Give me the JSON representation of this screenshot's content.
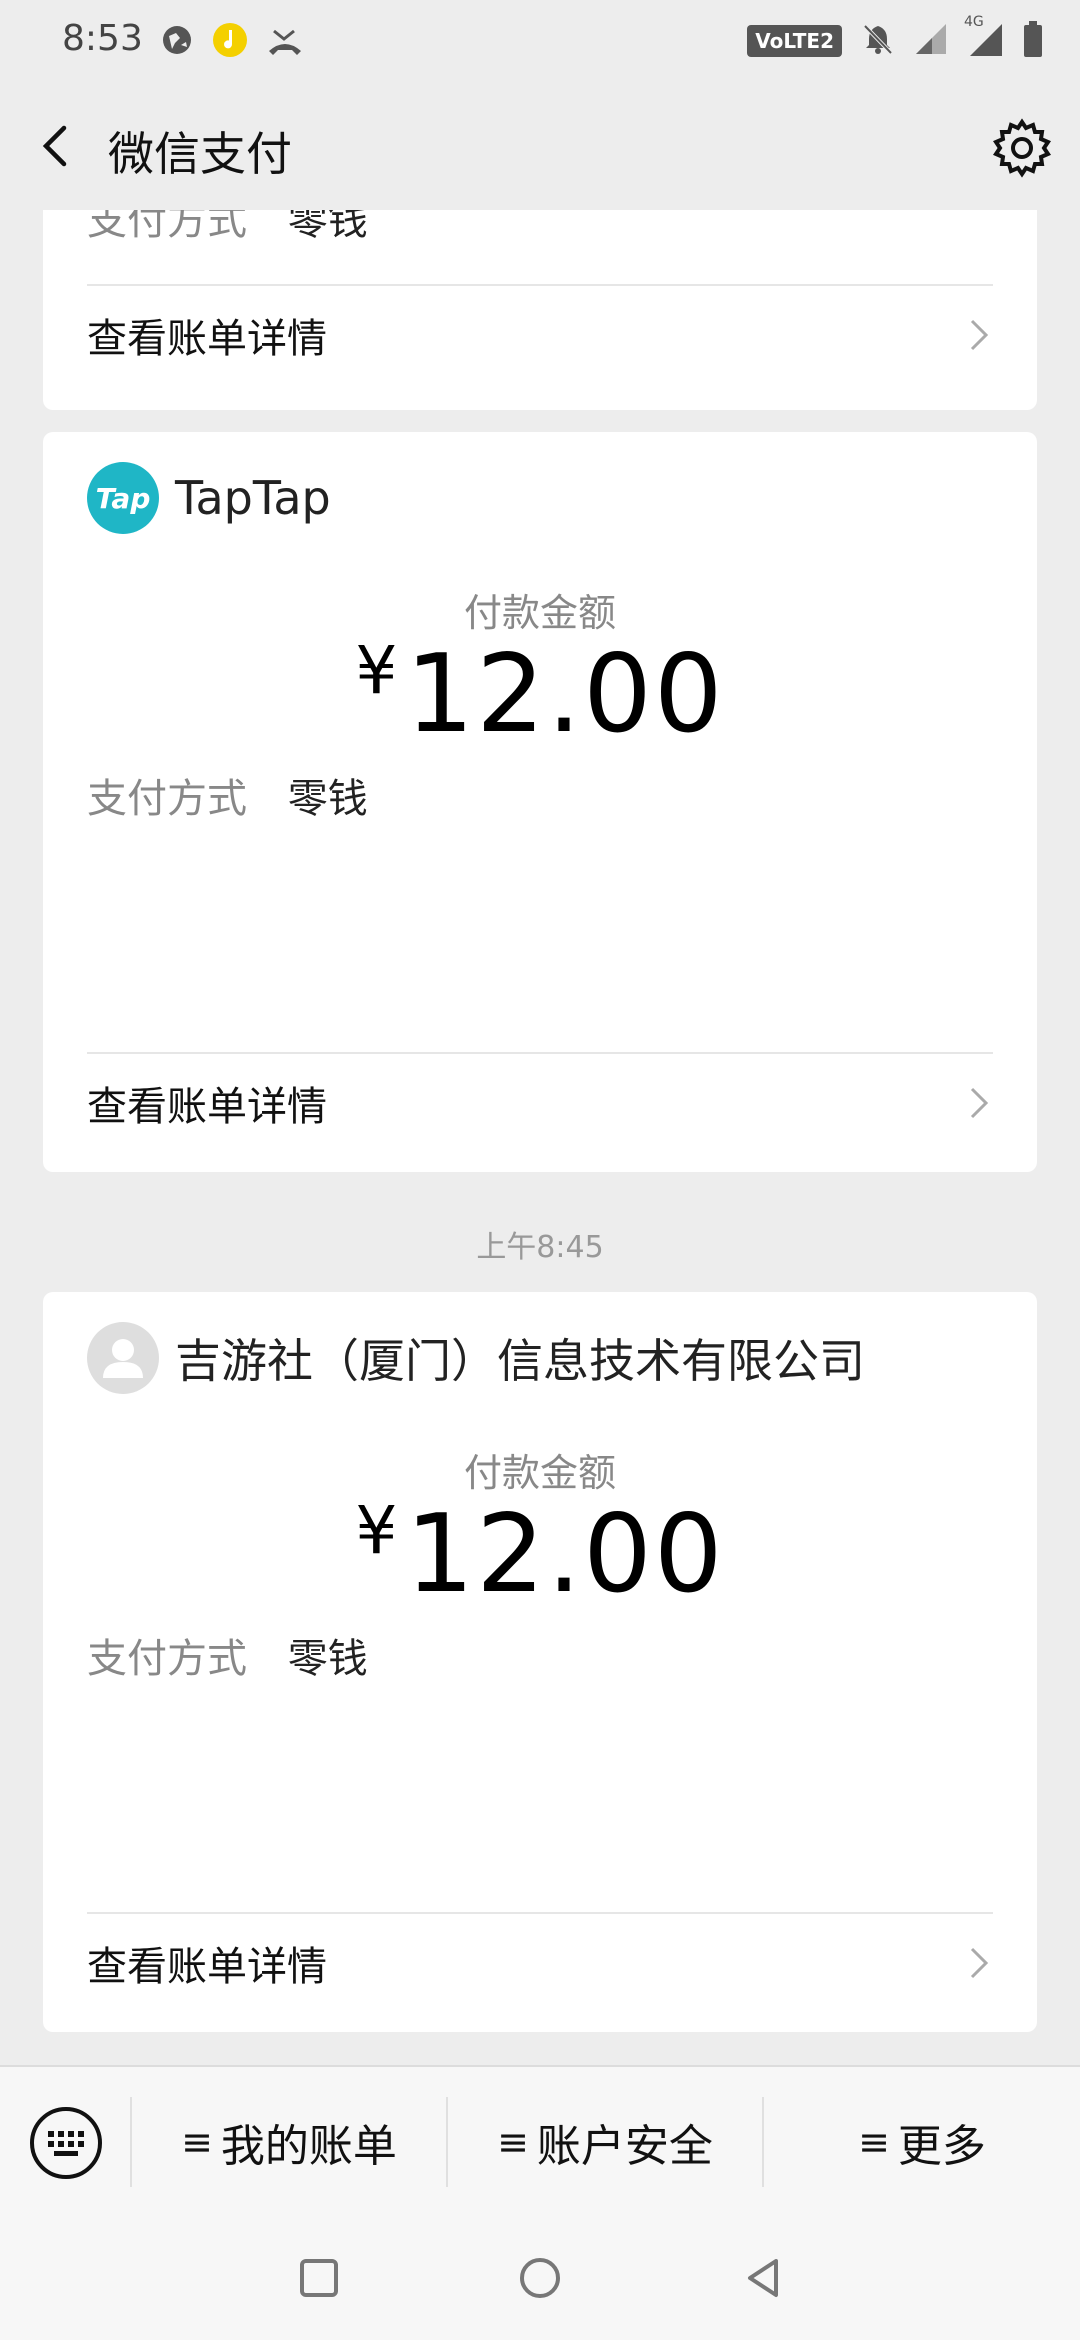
{
  "status_bar": {
    "time": "8:53",
    "left_icons": [
      "globe-icon",
      "music-note-icon",
      "missed-call-icon"
    ],
    "volte_label": "VoLTE2",
    "network_label": "4G",
    "right_icons": [
      "bell-off-icon",
      "signal-icon",
      "signal-4g-icon",
      "battery-icon"
    ]
  },
  "header": {
    "title": "微信支付",
    "back_icon": "chevron-left-icon",
    "settings_icon": "gear-icon"
  },
  "partial_card": {
    "pay_method_label": "支付方式",
    "pay_method_value": "零钱",
    "detail_label": "查看账单详情"
  },
  "cards": [
    {
      "merchant": "TapTap",
      "logo_text": "Tap",
      "amount_label": "付款金额",
      "currency": "¥",
      "amount": "12.00",
      "pay_method_label": "支付方式",
      "pay_method_value": "零钱",
      "detail_label": "查看账单详情"
    },
    {
      "merchant": "吉游社（厦门）信息技术有限公司",
      "amount_label": "付款金额",
      "currency": "¥",
      "amount": "12.00",
      "pay_method_label": "支付方式",
      "pay_method_value": "零钱",
      "detail_label": "查看账单详情"
    }
  ],
  "timestamp": "上午8:45",
  "bottom_menu": {
    "keyboard_icon": "keyboard-icon",
    "prefix": "≡",
    "items": [
      "我的账单",
      "账户安全",
      "更多"
    ]
  },
  "nav_bar": {
    "icons": [
      "recent-apps-icon",
      "home-icon",
      "back-icon"
    ]
  },
  "colors": {
    "page_bg": "#ededed",
    "card_bg": "#ffffff",
    "taptap_brand": "#1fb6c6",
    "muted_text": "#888888"
  }
}
